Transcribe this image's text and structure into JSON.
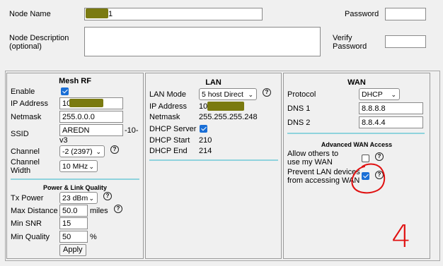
{
  "node": {
    "name_label": "Node Name",
    "name_value": "1",
    "password_label": "Password",
    "desc_label_1": "Node Description",
    "desc_label_2": "(optional)",
    "verify_label_1": "Verify",
    "verify_label_2": "Password"
  },
  "mesh": {
    "title": "Mesh RF",
    "enable_label": "Enable",
    "ip_label": "IP Address",
    "ip_value": "10.",
    "netmask_label": "Netmask",
    "netmask_value": "255.0.0.0",
    "ssid_label": "SSID",
    "ssid_value": "AREDN",
    "ssid_suffix_1": "-10-",
    "ssid_suffix_2": "v3",
    "channel_label": "Channel",
    "channel_value": "-2 (2397)",
    "width_label_1": "Channel",
    "width_label_2": "Width",
    "width_value": "10 MHz",
    "power_title": "Power & Link Quality",
    "tx_label": "Tx Power",
    "tx_value": "23 dBm",
    "maxdist_label": "Max Distance",
    "maxdist_value": "50.0",
    "maxdist_unit": "miles",
    "minsnr_label": "Min SNR",
    "minsnr_value": "15",
    "minq_label": "Min Quality",
    "minq_value": "50",
    "minq_unit": "%",
    "apply_label": "Apply"
  },
  "lan": {
    "title": "LAN",
    "mode_label": "LAN Mode",
    "mode_value": "5 host Direct",
    "ip_label": "IP Address",
    "ip_value": "10.",
    "netmask_label": "Netmask",
    "netmask_value": "255.255.255.248",
    "dhcp_label": "DHCP Server",
    "start_label": "DHCP Start",
    "start_value": "210",
    "end_label": "DHCP End",
    "end_value": "214"
  },
  "wan": {
    "title": "WAN",
    "protocol_label": "Protocol",
    "protocol_value": "DHCP",
    "dns1_label": "DNS 1",
    "dns1_value": "8.8.8.8",
    "dns2_label": "DNS 2",
    "dns2_value": "8.8.4.4",
    "adv_title": "Advanced WAN Access",
    "allow_label_1": "Allow others to",
    "allow_label_2": "use my WAN",
    "prevent_label_1": "Prevent LAN devices",
    "prevent_label_2": "from accessing WAN"
  },
  "annotation": {
    "number": "4",
    "color": "#e01010"
  },
  "icons": [
    "help-icon",
    "checkbox-icon",
    "chevron-down-icon"
  ]
}
